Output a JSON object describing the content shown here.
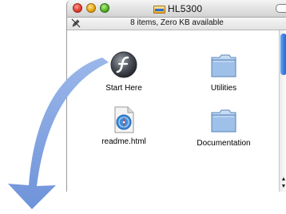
{
  "window": {
    "title": "HL5300",
    "status_text": "8 items, Zero KB available"
  },
  "items": [
    {
      "label": "Start Here",
      "icon": "flash-app-icon"
    },
    {
      "label": "Utilities",
      "icon": "folder-icon"
    },
    {
      "label": "readme.html",
      "icon": "html-document-icon"
    },
    {
      "label": "Documentation",
      "icon": "folder-icon"
    }
  ],
  "colors": {
    "arrow": "#7b9fe0",
    "scroll_thumb": "#2f7ae0",
    "folder": "#8fb6e8"
  }
}
